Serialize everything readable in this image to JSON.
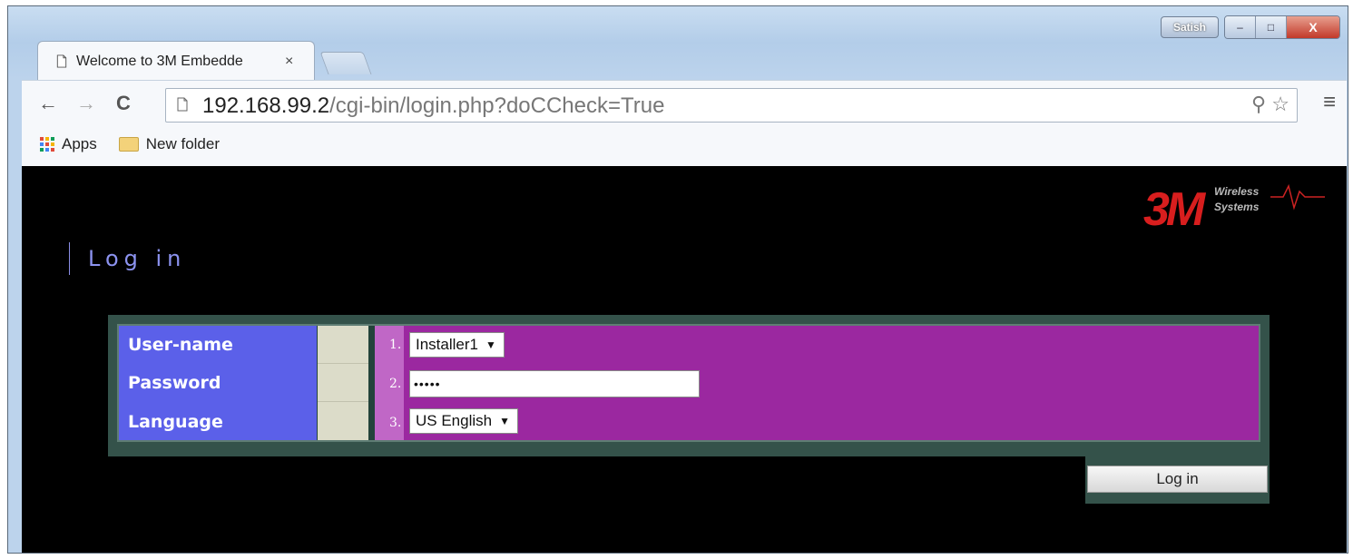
{
  "window": {
    "user_badge": "Satish",
    "minimize_glyph": "–",
    "maximize_glyph": "□",
    "close_glyph": "X"
  },
  "tab": {
    "title": "Welcome to 3M Embedde",
    "close_glyph": "×"
  },
  "toolbar": {
    "back_glyph": "←",
    "forward_glyph": "→",
    "reload_glyph": "C",
    "url_host": "192.168.99.2",
    "url_path": "/cgi-bin/login.php?doCCheck=True",
    "zoom_icon": "⚲",
    "star_icon": "☆",
    "menu_icon": "≡"
  },
  "bookmarks": {
    "apps_label": "Apps",
    "folder_label": "New folder"
  },
  "logo": {
    "brand": "3M",
    "line1": "Wireless",
    "line2": "Systems"
  },
  "page": {
    "heading": "Log in"
  },
  "form": {
    "fields": [
      {
        "number": "1.",
        "label": "User-name",
        "value": "Installer1"
      },
      {
        "number": "2.",
        "label": "Password",
        "value": "•••••"
      },
      {
        "number": "3.",
        "label": "Language",
        "value": "US English"
      }
    ],
    "select_arrow": "▼",
    "login_button": "Log in"
  },
  "colors": {
    "label_column": "#5b60e9",
    "field_column": "#9b28a0",
    "number_column": "#c067c6",
    "frame": "#34524a",
    "heading": "#8c93f0",
    "logo_red": "#d81e1e"
  }
}
